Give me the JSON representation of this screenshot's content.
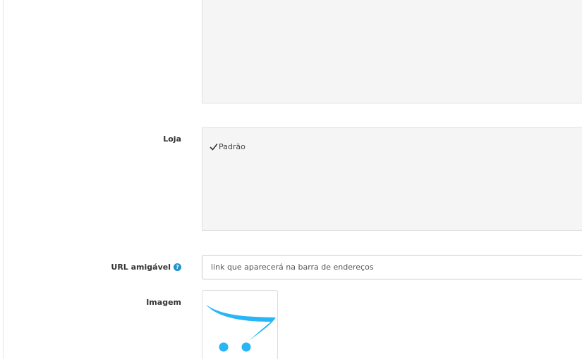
{
  "form": {
    "store": {
      "label": "Loja",
      "options": [
        {
          "name": "Padrão",
          "checked": true
        }
      ]
    },
    "seo_url": {
      "label": "URL amigável",
      "help_icon": "question-circle-icon",
      "value": "",
      "placeholder": "link que aparecerá na barra de endereços"
    },
    "image": {
      "label": "Imagem",
      "placeholder_icon": "cart-logo-icon"
    }
  },
  "colors": {
    "accent": "#1e91cf",
    "cart_logo": "#29b6f6",
    "box_background": "#f5f5f5"
  }
}
